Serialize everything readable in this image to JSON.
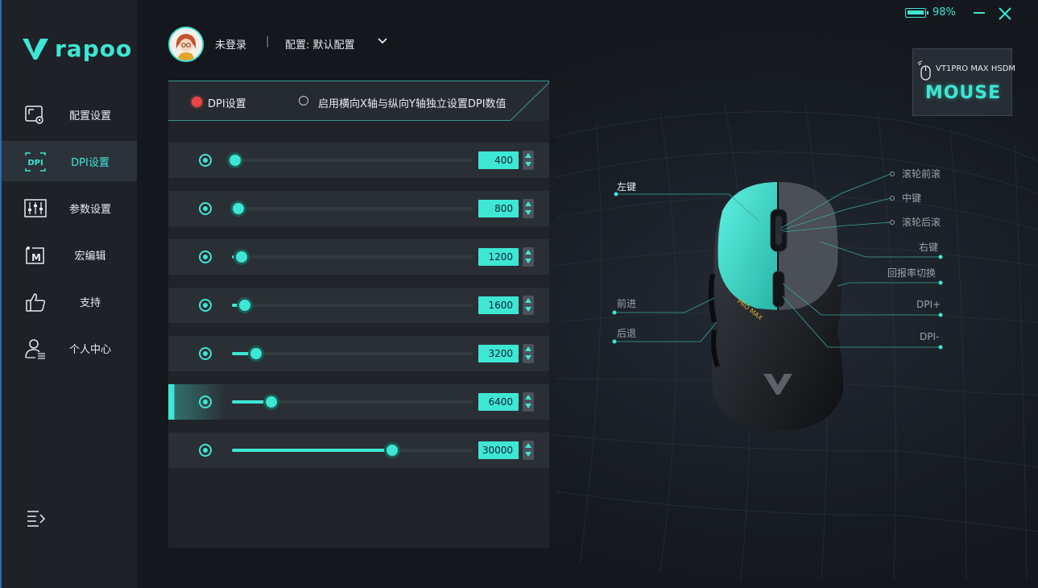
{
  "brand": {
    "logo_text": "rapoo"
  },
  "sidebar": {
    "items": [
      {
        "label": "配置设置",
        "icon": "config-settings-icon",
        "active": false
      },
      {
        "label": "DPI设置",
        "icon": "dpi-icon",
        "active": true
      },
      {
        "label": "参数设置",
        "icon": "sliders-icon",
        "active": false
      },
      {
        "label": "宏编辑",
        "icon": "macro-icon",
        "active": false
      },
      {
        "label": "支持",
        "icon": "thumbs-up-icon",
        "active": false
      },
      {
        "label": "个人中心",
        "icon": "user-center-icon",
        "active": false
      }
    ],
    "collapse_icon": "menu-collapse-icon"
  },
  "header": {
    "user_name": "未登录",
    "separator": "|",
    "profile_label": "配置: 默认配置"
  },
  "window": {
    "battery_percent": "98%",
    "battery_level": 0.98,
    "minimize_icon": "minimize-icon",
    "close_icon": "close-icon"
  },
  "dpi_panel": {
    "tab_dpi": "DPI设置",
    "tab_xy": "启用横向X轴与纵向Y轴独立设置DPI数值",
    "rows": [
      {
        "value": "400",
        "level": 0.013
      },
      {
        "value": "800",
        "level": 0.027
      },
      {
        "value": "1200",
        "level": 0.04
      },
      {
        "value": "1600",
        "level": 0.054
      },
      {
        "value": "3200",
        "level": 0.1
      },
      {
        "value": "6400",
        "level": 0.163
      },
      {
        "value": "30000",
        "level": 0.663
      }
    ],
    "selected_row": 5
  },
  "device": {
    "model": "VT1PRO MAX HSDM",
    "title": "MOUSE",
    "mouse_print": "PRO MAX"
  },
  "mouse_callouts": {
    "left": "左键",
    "scroll_up": "滚轮前滚",
    "middle": "中键",
    "scroll_down": "滚轮后滚",
    "right": "右键",
    "polling": "回报率切换",
    "dpi_plus": "DPI+",
    "dpi_minus": "DPI-",
    "forward": "前进",
    "back": "后退"
  },
  "colors": {
    "accent": "#3ee6d4",
    "active_dot": "#e84545",
    "panel": "#202429",
    "sidebar": "#1e2228"
  }
}
